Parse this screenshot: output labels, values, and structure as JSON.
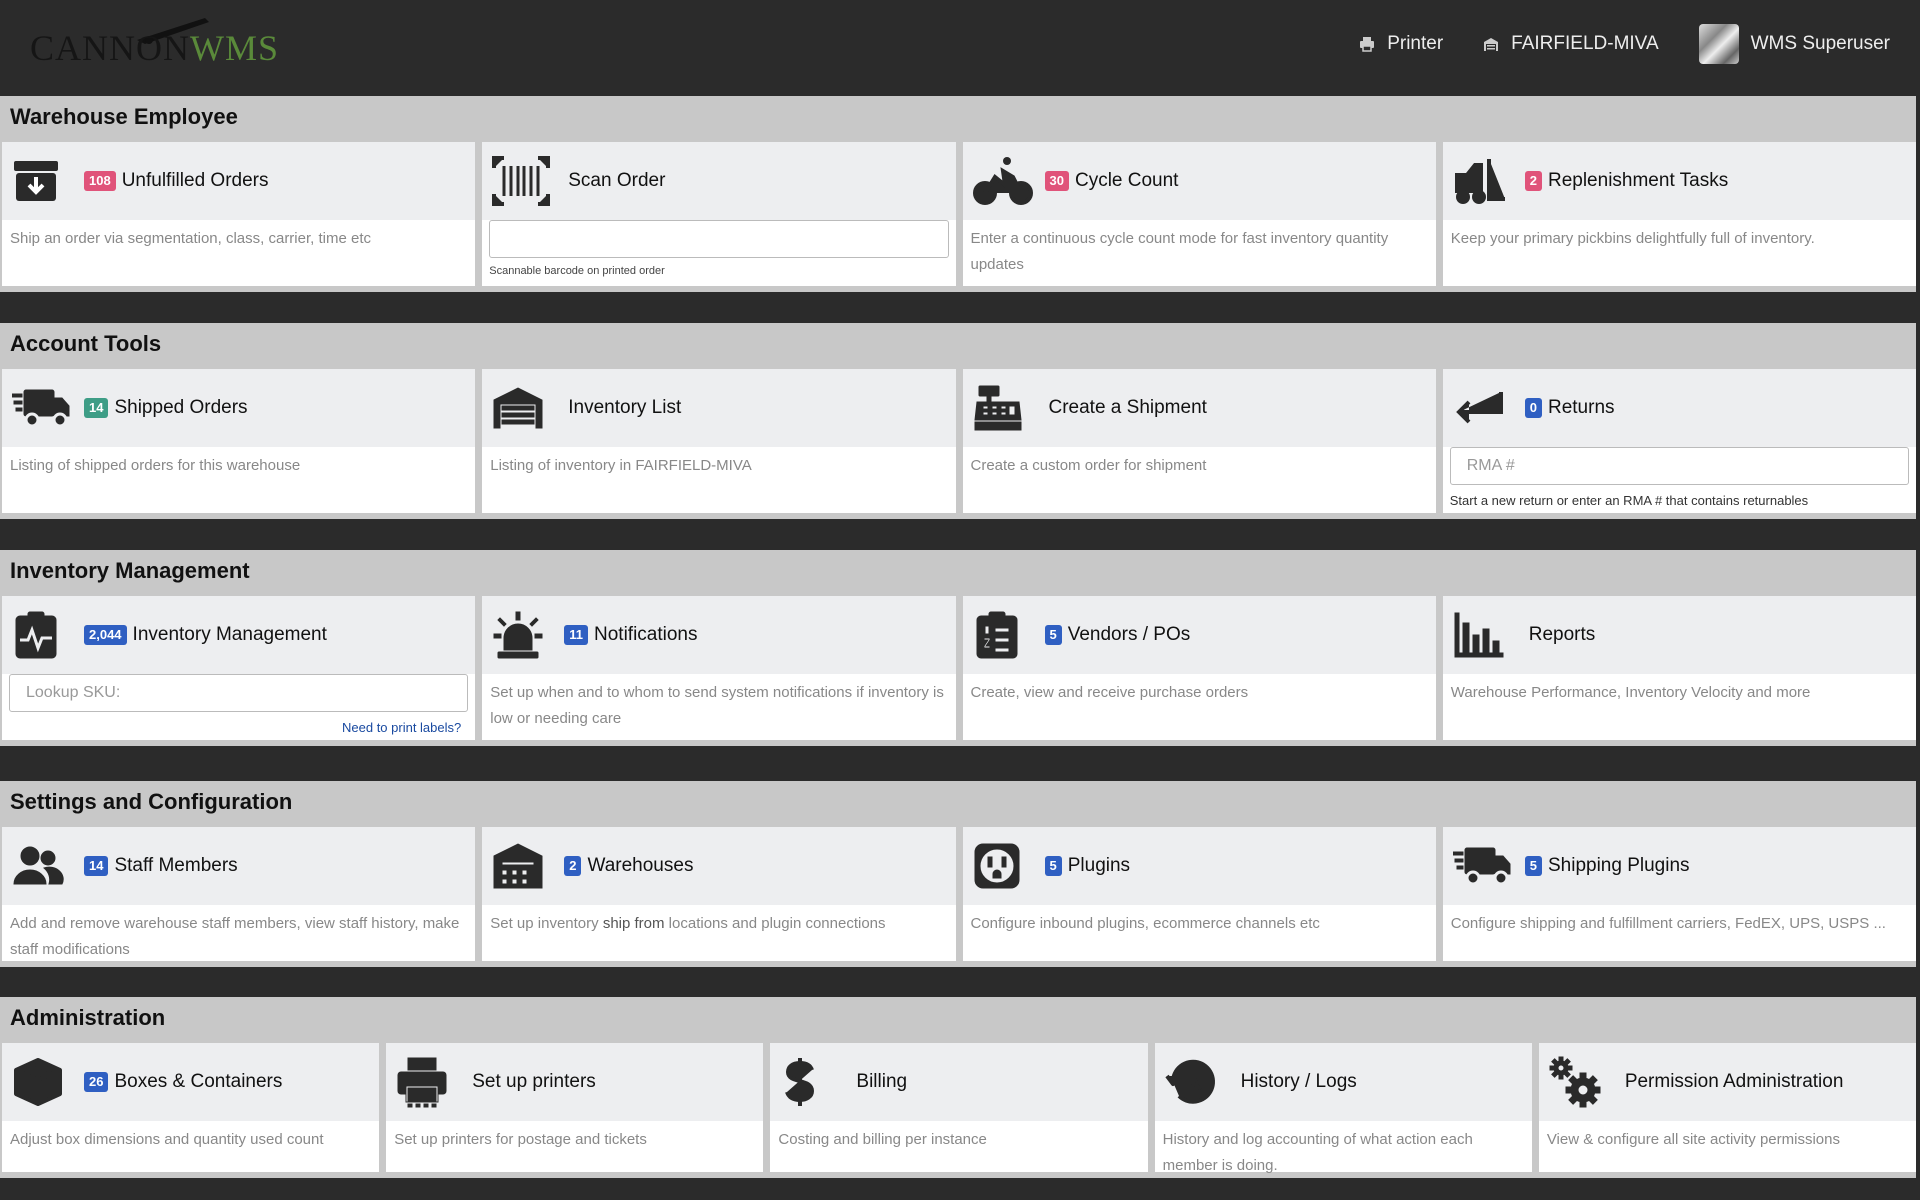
{
  "header": {
    "logo_text_1": "CANNON",
    "logo_text_2": "WMS",
    "printer_label": "Printer",
    "warehouse_label": "FAIRFIELD-MIVA",
    "user_label": "WMS Superuser"
  },
  "sections": {
    "warehouse_employee": {
      "title": "Warehouse Employee",
      "unfulfilled": {
        "badge": "108",
        "title": "Unfulfilled Orders",
        "desc": "Ship an order via segmentation, class, carrier, time etc"
      },
      "scan_order": {
        "title": "Scan Order",
        "input_value": "",
        "note": "Scannable barcode on printed order"
      },
      "cycle_count": {
        "badge": "30",
        "title": "Cycle Count",
        "desc": "Enter a continuous cycle count mode for fast inventory quantity updates"
      },
      "replenishment": {
        "badge": "2",
        "title": "Replenishment Tasks",
        "desc": "Keep your primary pickbins delightfully full of inventory."
      }
    },
    "account_tools": {
      "title": "Account Tools",
      "shipped": {
        "badge": "14",
        "title": "Shipped Orders",
        "desc": "Listing of shipped orders for this warehouse"
      },
      "inventory_list": {
        "title": "Inventory List",
        "desc": "Listing of inventory in FAIRFIELD-MIVA"
      },
      "create_shipment": {
        "title": "Create a Shipment",
        "desc": "Create a custom order for shipment"
      },
      "returns": {
        "badge": "0",
        "title": "Returns",
        "placeholder": "RMA #",
        "note": "Start a new return or enter an RMA # that contains returnables"
      }
    },
    "inventory_management": {
      "title": "Inventory Management",
      "inv_mgmt": {
        "badge": "2,044",
        "title": "Inventory Management",
        "placeholder": "Lookup SKU:",
        "link": "Need to print labels?"
      },
      "notifications": {
        "badge": "11",
        "title": "Notifications",
        "desc": "Set up when and to whom to send system notifications if inventory is low or needing care"
      },
      "vendors": {
        "badge": "5",
        "title": "Vendors / POs",
        "desc": "Create, view and receive purchase orders"
      },
      "reports": {
        "title": "Reports",
        "desc": "Warehouse Performance, Inventory Velocity and more"
      }
    },
    "settings": {
      "title": "Settings and Configuration",
      "staff": {
        "badge": "14",
        "title": "Staff Members",
        "desc": "Add and remove warehouse staff members, view staff history, make staff modifications"
      },
      "warehouses": {
        "badge": "2",
        "title": "Warehouses",
        "desc_1": "Set up inventory ",
        "desc_bold": "ship from",
        "desc_2": " locations and plugin connections"
      },
      "plugins": {
        "badge": "5",
        "title": "Plugins",
        "desc": "Configure inbound plugins, ecommerce channels etc"
      },
      "shipping_plugins": {
        "badge": "5",
        "title": "Shipping Plugins",
        "desc": "Configure shipping and fulfillment carriers, FedEX, UPS, USPS ..."
      }
    },
    "administration": {
      "title": "Administration",
      "boxes": {
        "badge": "26",
        "title": "Boxes & Containers",
        "desc": "Adjust box dimensions and quantity used count"
      },
      "printers": {
        "title": "Set up printers",
        "desc": "Set up printers for postage and tickets"
      },
      "billing": {
        "title": "Billing",
        "desc": "Costing and billing per instance"
      },
      "history": {
        "title": "History / Logs",
        "desc": "History and log accounting of what action each member is doing."
      },
      "permissions": {
        "title": "Permission Administration",
        "desc": "View & configure all site activity permissions"
      }
    }
  }
}
